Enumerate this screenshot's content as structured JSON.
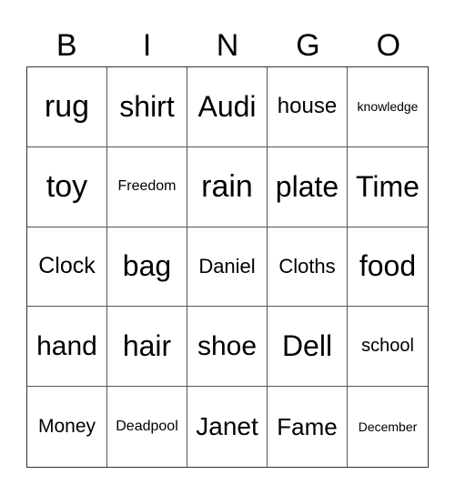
{
  "header": [
    "B",
    "I",
    "N",
    "G",
    "O"
  ],
  "cells": [
    {
      "text": "rug",
      "size": 34
    },
    {
      "text": "shirt",
      "size": 32
    },
    {
      "text": "Audi",
      "size": 32
    },
    {
      "text": "house",
      "size": 24
    },
    {
      "text": "knowledge",
      "size": 14
    },
    {
      "text": "toy",
      "size": 34
    },
    {
      "text": "Freedom",
      "size": 16
    },
    {
      "text": "rain",
      "size": 34
    },
    {
      "text": "plate",
      "size": 32
    },
    {
      "text": "Time",
      "size": 32
    },
    {
      "text": "Clock",
      "size": 25
    },
    {
      "text": "bag",
      "size": 32
    },
    {
      "text": "Daniel",
      "size": 22
    },
    {
      "text": "Cloths",
      "size": 22
    },
    {
      "text": "food",
      "size": 32
    },
    {
      "text": "hand",
      "size": 30
    },
    {
      "text": "hair",
      "size": 32
    },
    {
      "text": "shoe",
      "size": 30
    },
    {
      "text": "Dell",
      "size": 32
    },
    {
      "text": "school",
      "size": 20
    },
    {
      "text": "Money",
      "size": 21
    },
    {
      "text": "Deadpool",
      "size": 16
    },
    {
      "text": "Janet",
      "size": 28
    },
    {
      "text": "Fame",
      "size": 26
    },
    {
      "text": "December",
      "size": 14
    }
  ]
}
